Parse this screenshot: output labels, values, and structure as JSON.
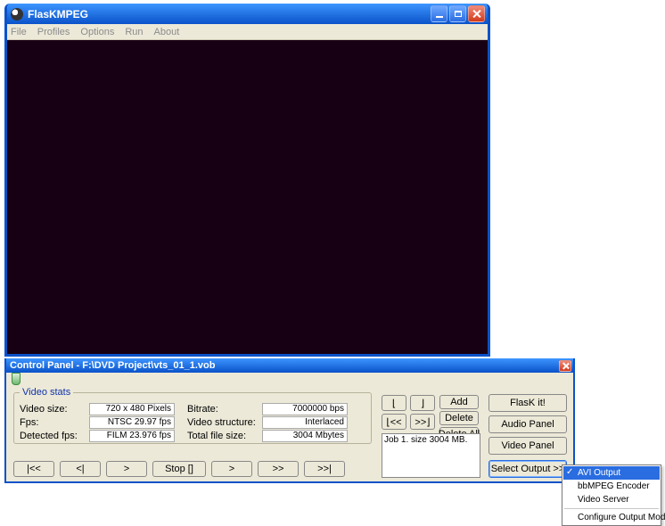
{
  "main_window": {
    "title": "FlasKMPEG",
    "menu": [
      "File",
      "Profiles",
      "Options",
      "Run",
      "About"
    ]
  },
  "control_panel": {
    "title": "Control Panel - F:\\DVD Project\\vts_01_1.vob",
    "group_title": "Video stats",
    "stats_left": {
      "video_size_label": "Video size:",
      "video_size_value": "720 x 480 Pixels",
      "fps_label": "Fps:",
      "fps_value": "NTSC 29.97 fps",
      "detected_fps_label": "Detected fps:",
      "detected_fps_value": "FILM 23.976 fps"
    },
    "stats_right": {
      "bitrate_label": "Bitrate:",
      "bitrate_value": "7000000 bps",
      "video_structure_label": "Video structure:",
      "video_structure_value": "Interlaced",
      "total_size_label": "Total file size:",
      "total_size_value": "3004 Mbytes"
    },
    "bracket": {
      "left": "⌊",
      "right": "⌋",
      "ll": "⌊<<",
      "rr": ">>⌋"
    },
    "job_button": {
      "add": "Add",
      "delete": "Delete",
      "delete_all": "Delete All"
    },
    "job_list": {
      "item0": "Job 1. size 3004 MB."
    },
    "side_buttons": {
      "flask": "FlasK it!",
      "audio": "Audio Panel",
      "video": "Video Panel",
      "select_output": "Select Output >>"
    },
    "transport": {
      "first": "|<<",
      "prev": "<|",
      "play": ">",
      "stop": "Stop []",
      "step": ">",
      "ff": ">>",
      "last": ">>|"
    }
  },
  "popup": {
    "avi": "AVI Output",
    "bbmpeg": "bbMPEG Encoder",
    "vserver": "Video Server",
    "config": "Configure Output Module"
  }
}
